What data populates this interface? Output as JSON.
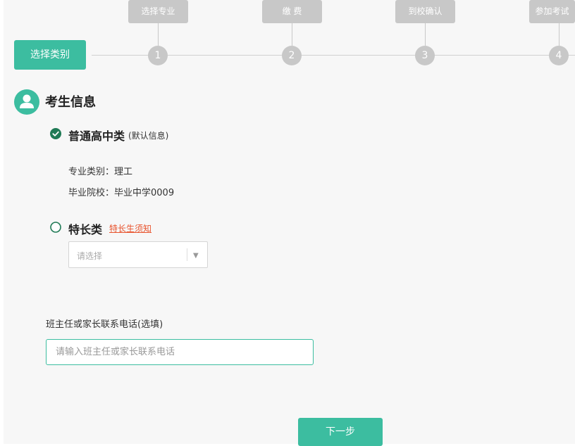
{
  "stepper": {
    "current_label": "选择类别",
    "steps": [
      {
        "label": "选择专业",
        "number": "1"
      },
      {
        "label": "缴 费",
        "number": "2"
      },
      {
        "label": "到校确认",
        "number": "3"
      },
      {
        "label": "参加考试",
        "number": "4"
      }
    ]
  },
  "section": {
    "title": "考生信息",
    "icon": "user-avatar-icon"
  },
  "options": {
    "regular": {
      "title": "普通高中类",
      "note": "(默认信息)",
      "selected": true,
      "major_line": "专业类别：理工",
      "school_line": "毕业院校：毕业中学0009"
    },
    "special": {
      "title": "特长类",
      "notice_link": "特长生须知",
      "selected": false,
      "select_placeholder": "请选择"
    }
  },
  "phone": {
    "label": "班主任或家长联系电话(选填)",
    "placeholder": "请输入班主任或家长联系电话"
  },
  "next_button": "下一步",
  "colors": {
    "accent": "#3cbda0",
    "step_inactive": "#c8c8c8",
    "check_dark": "#1f7a55",
    "link": "#e8542e"
  }
}
